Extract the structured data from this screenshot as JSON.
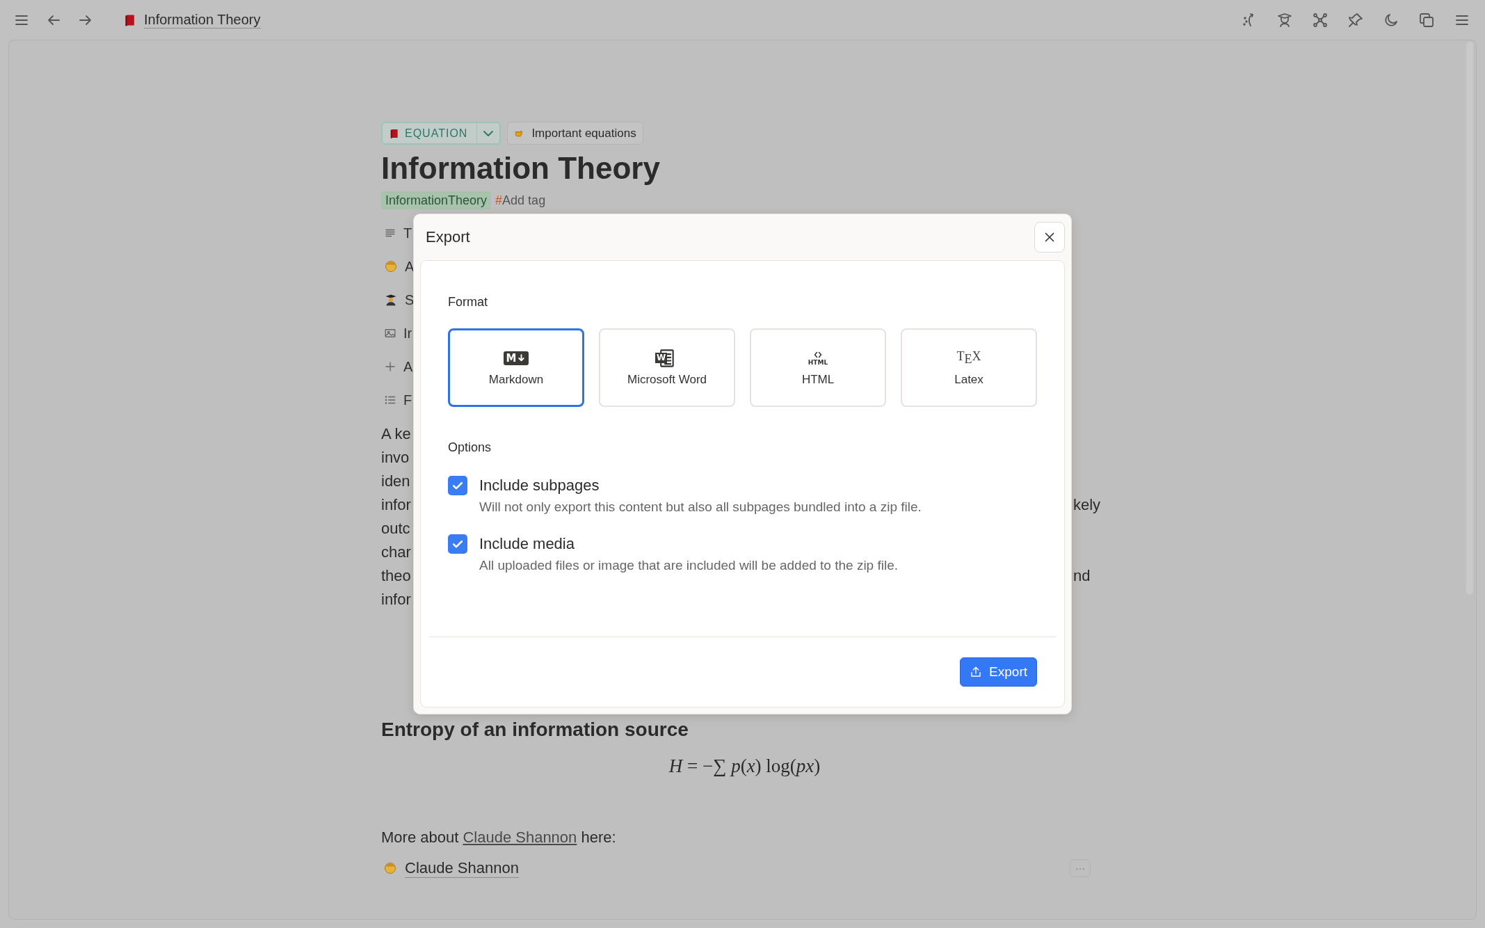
{
  "topbar": {
    "title": "Information Theory"
  },
  "page": {
    "chips": [
      {
        "kind": "type",
        "label": "EQUATION"
      },
      {
        "kind": "collection",
        "label": "Important equations"
      }
    ],
    "title": "Information Theory",
    "tags": [
      "InformationTheory"
    ],
    "add_tag": {
      "symbol": "#",
      "label": "Add tag"
    },
    "properties": [
      {
        "kind": "text",
        "label": "T"
      },
      {
        "kind": "person",
        "label": "A"
      },
      {
        "kind": "student",
        "label": "S"
      },
      {
        "kind": "image",
        "label": "Ir"
      },
      {
        "kind": "add",
        "label": "A"
      },
      {
        "kind": "list",
        "label": "F"
      }
    ],
    "paragraph_lines": [
      {
        "left": "A ke"
      },
      {
        "left": "invo"
      },
      {
        "left": "iden"
      },
      {
        "left": "infor",
        "right": "kely"
      },
      {
        "left": "outc"
      },
      {
        "left": "char"
      },
      {
        "left": "theo",
        "right": "nd"
      },
      {
        "left": "infor"
      }
    ],
    "heading": "Entropy of an information source",
    "formula": "*H* = −∑ *p*(*x*) log(*px*)",
    "more_about": {
      "before": "More about",
      "link": "Claude Shannon",
      "after": "here:"
    },
    "mention": "Claude Shannon",
    "more_button": "···"
  },
  "dialog": {
    "title": "Export",
    "format_label": "Format",
    "formats": [
      {
        "kind": "markdown",
        "label": "Markdown",
        "icon_text": "M",
        "selected": true
      },
      {
        "kind": "word",
        "label": "Microsoft Word",
        "icon_text": "W",
        "selected": false
      },
      {
        "kind": "html",
        "label": "HTML",
        "icon_text": "HTML",
        "selected": false
      },
      {
        "kind": "latex",
        "label": "Latex",
        "icon_text": "T$_{E}$X",
        "selected": false
      }
    ],
    "options_label": "Options",
    "options": [
      {
        "label": "Include subpages",
        "description": "Will not only export this content but also all subpages bundled into a zip file.",
        "checked": true
      },
      {
        "label": "Include media",
        "description": "All uploaded files or image that are included will be added to the zip file.",
        "checked": true
      }
    ],
    "button": "Export"
  }
}
